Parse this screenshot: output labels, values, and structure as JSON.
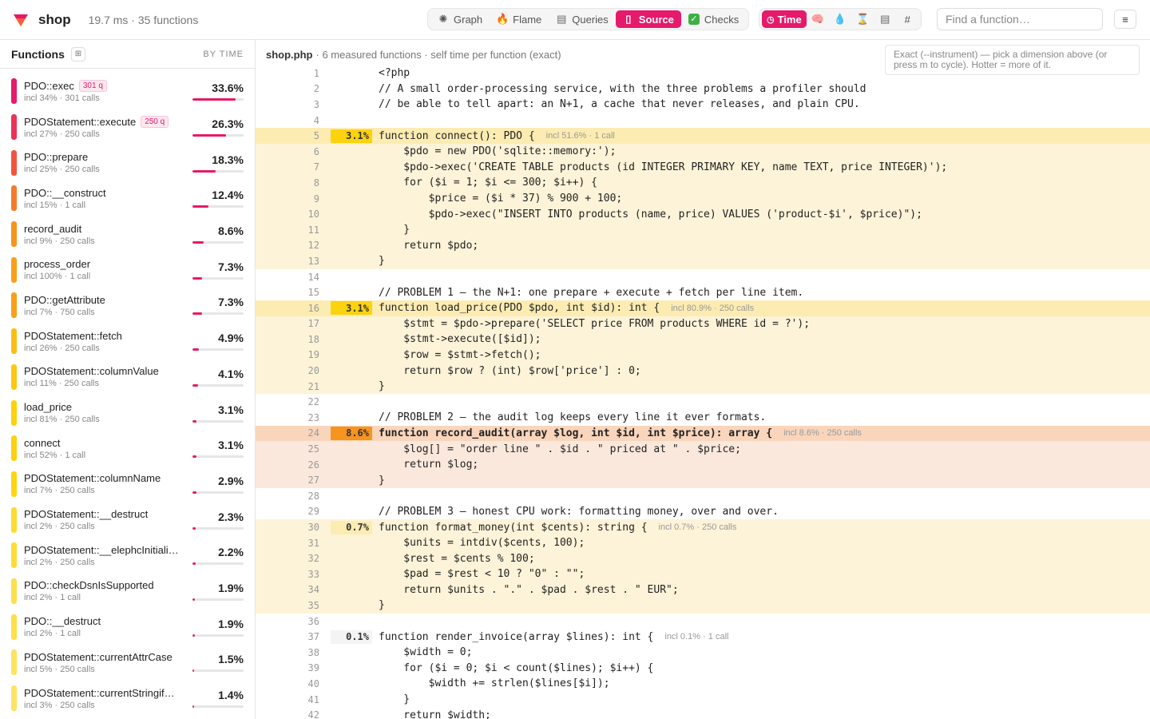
{
  "app": {
    "name": "shop",
    "stats": "19.7 ms · 35 functions"
  },
  "nav": {
    "tabs": [
      {
        "label": "Graph",
        "icon": "graph-icon",
        "active": false
      },
      {
        "label": "Flame",
        "icon": "flame-icon",
        "active": false
      },
      {
        "label": "Queries",
        "icon": "database-icon",
        "active": false
      },
      {
        "label": "Source",
        "icon": "document-icon",
        "active": true
      },
      {
        "label": "Checks",
        "icon": "checkmark-icon",
        "active": false
      }
    ]
  },
  "dimensions": {
    "time_label": "Time",
    "others": [
      {
        "icon": "brain-icon",
        "glyph": "🧠"
      },
      {
        "icon": "droplet-icon",
        "glyph": "💧"
      },
      {
        "icon": "hourglass-icon",
        "glyph": "⌛"
      },
      {
        "icon": "database-icon",
        "glyph": "🗄"
      },
      {
        "icon": "hash-icon",
        "glyph": "#"
      }
    ]
  },
  "search": {
    "placeholder": "Find a function…"
  },
  "sidebar": {
    "title": "Functions",
    "sort_label": "BY TIME",
    "functions": [
      {
        "name": "PDO::exec",
        "badge": "301 q",
        "sub": "incl 34% · 301 calls",
        "pct": "33.6%",
        "value": 33.6,
        "color": "#e6196b"
      },
      {
        "name": "PDOStatement::execute",
        "badge": "250 q",
        "sub": "incl 27% · 250 calls",
        "pct": "26.3%",
        "value": 26.3,
        "color": "#eb3358"
      },
      {
        "name": "PDO::prepare",
        "badge": "",
        "sub": "incl 25% · 250 calls",
        "pct": "18.3%",
        "value": 18.3,
        "color": "#f2553f"
      },
      {
        "name": "PDO::__construct",
        "badge": "",
        "sub": "incl 15% · 1 call",
        "pct": "12.4%",
        "value": 12.4,
        "color": "#f47a2c"
      },
      {
        "name": "record_audit",
        "badge": "",
        "sub": "incl 9% · 250 calls",
        "pct": "8.6%",
        "value": 8.6,
        "color": "#f7941e"
      },
      {
        "name": "process_order",
        "badge": "",
        "sub": "incl 100% · 1 call",
        "pct": "7.3%",
        "value": 7.3,
        "color": "#f8a01c"
      },
      {
        "name": "PDO::getAttribute",
        "badge": "",
        "sub": "incl 7% · 750 calls",
        "pct": "7.3%",
        "value": 7.3,
        "color": "#f8a01c"
      },
      {
        "name": "PDOStatement::fetch",
        "badge": "",
        "sub": "incl 26% · 250 calls",
        "pct": "4.9%",
        "value": 4.9,
        "color": "#fbbf14"
      },
      {
        "name": "PDOStatement::columnValue",
        "badge": "",
        "sub": "incl 11% · 250 calls",
        "pct": "4.1%",
        "value": 4.1,
        "color": "#fcc812"
      },
      {
        "name": "load_price",
        "badge": "",
        "sub": "incl 81% · 250 calls",
        "pct": "3.1%",
        "value": 3.1,
        "color": "#fdd20f"
      },
      {
        "name": "connect",
        "badge": "",
        "sub": "incl 52% · 1 call",
        "pct": "3.1%",
        "value": 3.1,
        "color": "#fdd20f"
      },
      {
        "name": "PDOStatement::columnName",
        "badge": "",
        "sub": "incl 7% · 250 calls",
        "pct": "2.9%",
        "value": 2.9,
        "color": "#fdd612"
      },
      {
        "name": "PDOStatement::__destruct",
        "badge": "",
        "sub": "incl 2% · 250 calls",
        "pct": "2.3%",
        "value": 2.3,
        "color": "#fddb30"
      },
      {
        "name": "PDOStatement::__elephcInitiali…",
        "badge": "",
        "sub": "incl 2% · 250 calls",
        "pct": "2.2%",
        "value": 2.2,
        "color": "#fddc38"
      },
      {
        "name": "PDO::checkDsnIsSupported",
        "badge": "",
        "sub": "incl 2% · 1 call",
        "pct": "1.9%",
        "value": 1.9,
        "color": "#fde04a"
      },
      {
        "name": "PDO::__destruct",
        "badge": "",
        "sub": "incl 2% · 1 call",
        "pct": "1.9%",
        "value": 1.9,
        "color": "#fde04a"
      },
      {
        "name": "PDOStatement::currentAttrCase",
        "badge": "",
        "sub": "incl 5% · 250 calls",
        "pct": "1.5%",
        "value": 1.5,
        "color": "#fde460"
      },
      {
        "name": "PDOStatement::currentStringif…",
        "badge": "",
        "sub": "incl 3% · 250 calls",
        "pct": "1.4%",
        "value": 1.4,
        "color": "#fde466"
      }
    ]
  },
  "main": {
    "file": "shop.php",
    "summary": "· 6 measured functions · self time per function (exact)",
    "help": "Exact (--instrument) — pick a dimension above (or press m to cycle). Hotter = more of it.",
    "lines": [
      {
        "n": "1",
        "code": "<?php",
        "style": ""
      },
      {
        "n": "2",
        "code": "// A small order-processing service, with the three problems a profiler should",
        "style": ""
      },
      {
        "n": "3",
        "code": "// be able to tell apart: an N+1, a cache that never releases, and plain CPU.",
        "style": ""
      },
      {
        "n": "4",
        "code": "",
        "style": ""
      },
      {
        "n": "5",
        "code": "function connect(): PDO {",
        "style": "hot-head",
        "gutter": "3.1%",
        "gutter_color": "#fdd20f",
        "incl": "incl 51.6% · 1 call"
      },
      {
        "n": "6",
        "code": "    $pdo = new PDO('sqlite::memory:');",
        "style": "hot-light"
      },
      {
        "n": "7",
        "code": "    $pdo->exec('CREATE TABLE products (id INTEGER PRIMARY KEY, name TEXT, price INTEGER)');",
        "style": "hot-light"
      },
      {
        "n": "8",
        "code": "    for ($i = 1; $i <= 300; $i++) {",
        "style": "hot-light"
      },
      {
        "n": "9",
        "code": "        $price = ($i * 37) % 900 + 100;",
        "style": "hot-light"
      },
      {
        "n": "10",
        "code": "        $pdo->exec(\"INSERT INTO products (name, price) VALUES ('product-$i', $price)\");",
        "style": "hot-light"
      },
      {
        "n": "11",
        "code": "    }",
        "style": "hot-light"
      },
      {
        "n": "12",
        "code": "    return $pdo;",
        "style": "hot-light"
      },
      {
        "n": "13",
        "code": "}",
        "style": "hot-light"
      },
      {
        "n": "14",
        "code": "",
        "style": ""
      },
      {
        "n": "15",
        "code": "// PROBLEM 1 — the N+1: one prepare + execute + fetch per line item.",
        "style": ""
      },
      {
        "n": "16",
        "code": "function load_price(PDO $pdo, int $id): int {",
        "style": "hot-head",
        "gutter": "3.1%",
        "gutter_color": "#fdd20f",
        "incl": "incl 80.9% · 250 calls"
      },
      {
        "n": "17",
        "code": "    $stmt = $pdo->prepare('SELECT price FROM products WHERE id = ?');",
        "style": "hot-light"
      },
      {
        "n": "18",
        "code": "    $stmt->execute([$id]);",
        "style": "hot-light"
      },
      {
        "n": "19",
        "code": "    $row = $stmt->fetch();",
        "style": "hot-light"
      },
      {
        "n": "20",
        "code": "    return $row ? (int) $row['price'] : 0;",
        "style": "hot-light"
      },
      {
        "n": "21",
        "code": "}",
        "style": "hot-light"
      },
      {
        "n": "22",
        "code": "",
        "style": ""
      },
      {
        "n": "23",
        "code": "// PROBLEM 2 — the audit log keeps every line it ever formats.",
        "style": ""
      },
      {
        "n": "24",
        "code": "function record_audit(array $log, int $id, int $price): array {",
        "style": "warm-head",
        "gutter": "8.6%",
        "gutter_color": "#f7941e",
        "incl": "incl 8.6% · 250 calls",
        "bold": true
      },
      {
        "n": "25",
        "code": "    $log[] = \"order line \" . $id . \" priced at \" . $price;",
        "style": "warm-light"
      },
      {
        "n": "26",
        "code": "    return $log;",
        "style": "warm-light"
      },
      {
        "n": "27",
        "code": "}",
        "style": "warm-light"
      },
      {
        "n": "28",
        "code": "",
        "style": ""
      },
      {
        "n": "29",
        "code": "// PROBLEM 3 — honest CPU work: formatting money, over and over.",
        "style": ""
      },
      {
        "n": "30",
        "code": "function format_money(int $cents): string {",
        "style": "hot-light",
        "gutter": "0.7%",
        "gutter_color": "#fcecb2",
        "incl": "incl 0.7% · 250 calls"
      },
      {
        "n": "31",
        "code": "    $units = intdiv($cents, 100);",
        "style": "hot-light"
      },
      {
        "n": "32",
        "code": "    $rest = $cents % 100;",
        "style": "hot-light"
      },
      {
        "n": "33",
        "code": "    $pad = $rest < 10 ? \"0\" : \"\";",
        "style": "hot-light"
      },
      {
        "n": "34",
        "code": "    return $units . \".\" . $pad . $rest . \" EUR\";",
        "style": "hot-light"
      },
      {
        "n": "35",
        "code": "}",
        "style": "hot-light"
      },
      {
        "n": "36",
        "code": "",
        "style": ""
      },
      {
        "n": "37",
        "code": "function render_invoice(array $lines): int {",
        "style": "",
        "gutter": "0.1%",
        "gutter_color": "#f4f4f4",
        "incl": "incl 0.1% · 1 call"
      },
      {
        "n": "38",
        "code": "    $width = 0;",
        "style": ""
      },
      {
        "n": "39",
        "code": "    for ($i = 0; $i < count($lines); $i++) {",
        "style": ""
      },
      {
        "n": "40",
        "code": "        $width += strlen($lines[$i]);",
        "style": ""
      },
      {
        "n": "41",
        "code": "    }",
        "style": ""
      },
      {
        "n": "42",
        "code": "    return $width;",
        "style": ""
      }
    ]
  }
}
